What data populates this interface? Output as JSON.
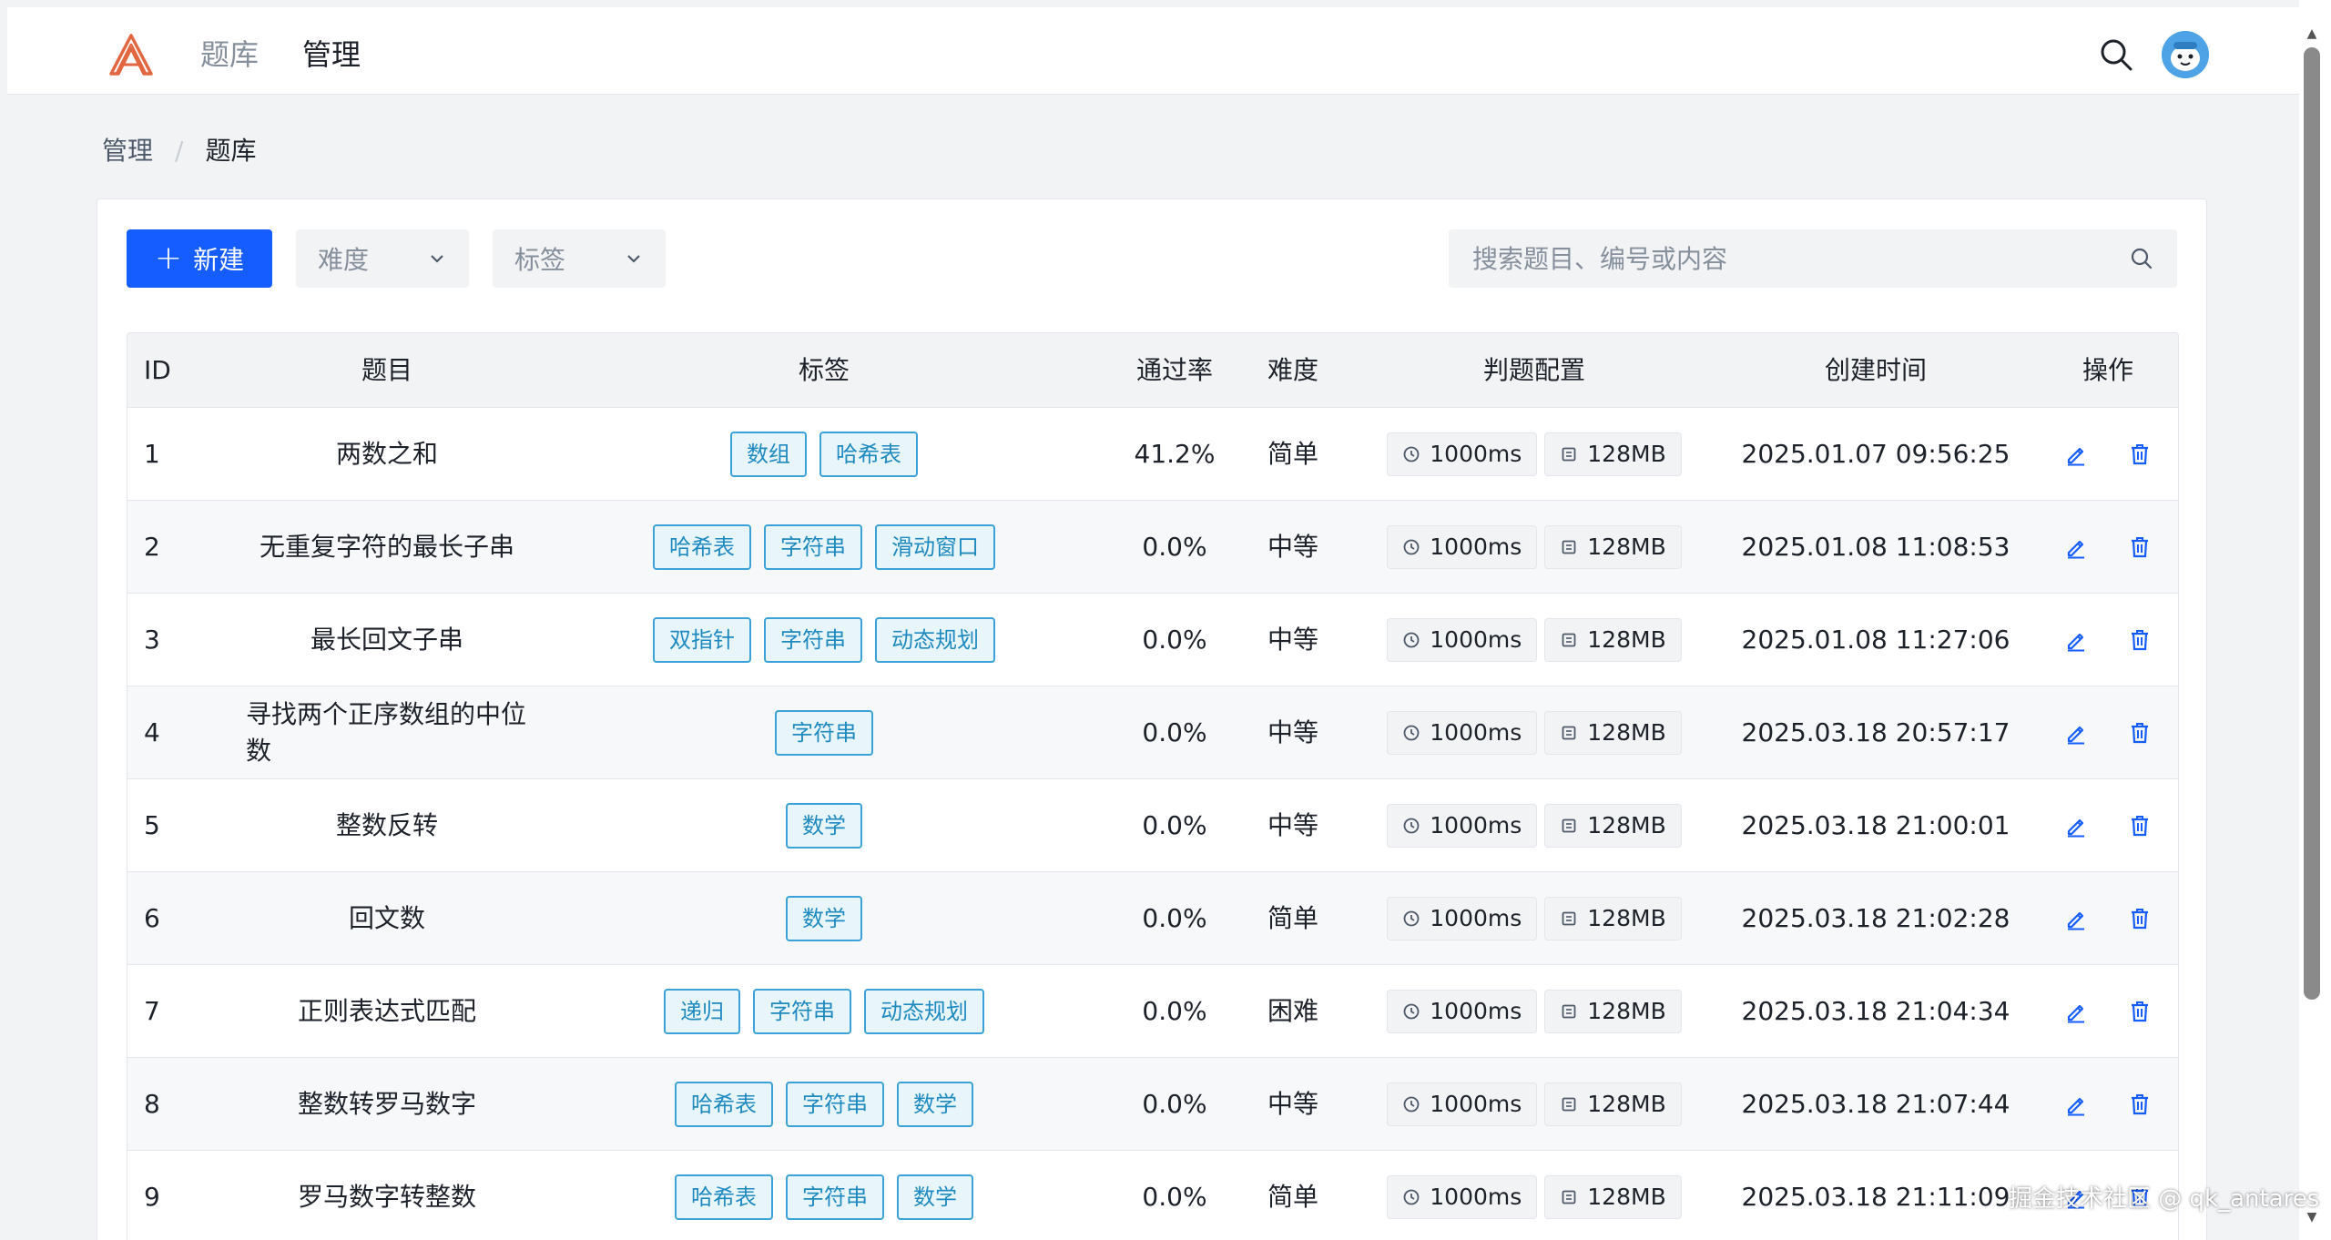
{
  "header": {
    "nav": [
      {
        "label": "题库"
      },
      {
        "label": "管理"
      }
    ]
  },
  "breadcrumb": {
    "root": "管理",
    "separator": "/",
    "current": "题库"
  },
  "toolbar": {
    "new_label": "新建",
    "difficulty_placeholder": "难度",
    "tag_placeholder": "标签",
    "search_placeholder": "搜索题目、编号或内容"
  },
  "table": {
    "columns": [
      "ID",
      "题目",
      "标签",
      "通过率",
      "难度",
      "判题配置",
      "创建时间",
      "操作"
    ],
    "rows": [
      {
        "id": "1",
        "title": "两数之和",
        "tags": [
          "数组",
          "哈希表"
        ],
        "rate": "41.2%",
        "difficulty": "简单",
        "time_limit": "1000ms",
        "memory": "128MB",
        "created": "2025.01.07 09:56:25"
      },
      {
        "id": "2",
        "title": "无重复字符的最长子串",
        "tags": [
          "哈希表",
          "字符串",
          "滑动窗口"
        ],
        "rate": "0.0%",
        "difficulty": "中等",
        "time_limit": "1000ms",
        "memory": "128MB",
        "created": "2025.01.08 11:08:53"
      },
      {
        "id": "3",
        "title": "最长回文子串",
        "tags": [
          "双指针",
          "字符串",
          "动态规划"
        ],
        "rate": "0.0%",
        "difficulty": "中等",
        "time_limit": "1000ms",
        "memory": "128MB",
        "created": "2025.01.08 11:27:06"
      },
      {
        "id": "4",
        "title": "寻找两个正序数组的中位数",
        "tags": [
          "字符串"
        ],
        "rate": "0.0%",
        "difficulty": "中等",
        "time_limit": "1000ms",
        "memory": "128MB",
        "created": "2025.03.18 20:57:17"
      },
      {
        "id": "5",
        "title": "整数反转",
        "tags": [
          "数学"
        ],
        "rate": "0.0%",
        "difficulty": "中等",
        "time_limit": "1000ms",
        "memory": "128MB",
        "created": "2025.03.18 21:00:01"
      },
      {
        "id": "6",
        "title": "回文数",
        "tags": [
          "数学"
        ],
        "rate": "0.0%",
        "difficulty": "简单",
        "time_limit": "1000ms",
        "memory": "128MB",
        "created": "2025.03.18 21:02:28"
      },
      {
        "id": "7",
        "title": "正则表达式匹配",
        "tags": [
          "递归",
          "字符串",
          "动态规划"
        ],
        "rate": "0.0%",
        "difficulty": "困难",
        "time_limit": "1000ms",
        "memory": "128MB",
        "created": "2025.03.18 21:04:34"
      },
      {
        "id": "8",
        "title": "整数转罗马数字",
        "tags": [
          "哈希表",
          "字符串",
          "数学"
        ],
        "rate": "0.0%",
        "difficulty": "中等",
        "time_limit": "1000ms",
        "memory": "128MB",
        "created": "2025.03.18 21:07:44"
      },
      {
        "id": "9",
        "title": "罗马数字转整数",
        "tags": [
          "哈希表",
          "字符串",
          "数学"
        ],
        "rate": "0.0%",
        "difficulty": "简单",
        "time_limit": "1000ms",
        "memory": "128MB",
        "created": "2025.03.18 21:11:09"
      }
    ]
  },
  "watermark": "掘金技术社区 @ qk_antares",
  "colors": {
    "primary": "#165dff",
    "tag_border": "#3ba2d8",
    "tag_text": "#1f8ac0",
    "logo": "#e0673f",
    "avatar": "#4ea3e6"
  },
  "icons": [
    "logo-icon",
    "search-icon",
    "avatar",
    "plus-icon",
    "chevron-down-icon",
    "clock-icon",
    "memory-icon",
    "edit-icon",
    "delete-icon"
  ]
}
